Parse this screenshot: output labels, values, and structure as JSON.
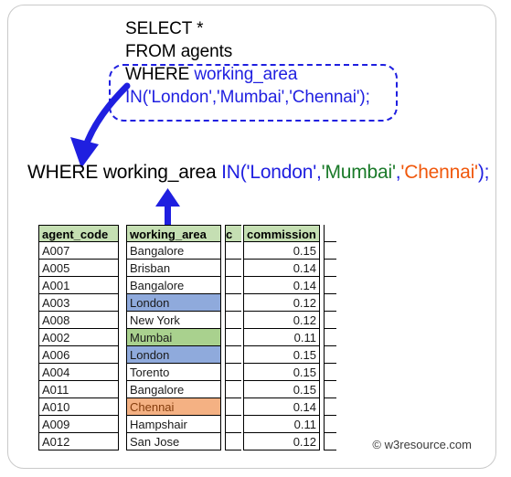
{
  "query": {
    "lines": [
      {
        "id": "l1",
        "segments": [
          {
            "text": "SELECT *",
            "color": "black"
          }
        ]
      },
      {
        "id": "l2",
        "segments": [
          {
            "text": "FROM agents",
            "color": "black"
          }
        ]
      },
      {
        "id": "l3",
        "segments": [
          {
            "text": "WHERE ",
            "color": "black"
          },
          {
            "text": "working_area",
            "color": "blue"
          }
        ]
      },
      {
        "id": "l4",
        "segments": [
          {
            "text": "IN('London','Mumbai','Chennai');",
            "color": "blue"
          }
        ]
      }
    ],
    "line1": "SELECT *",
    "line2": "FROM agents",
    "line3_keyword": "WHERE",
    "line3_column": "working_area",
    "line4": "IN('London','Mumbai','Chennai');"
  },
  "highlight_box": {
    "style": "dashed",
    "color": "#1f1fe0"
  },
  "arrows": {
    "curved": {
      "name": "curved-down-arrow",
      "color": "#1f1fe0"
    },
    "up": {
      "name": "up-arrow",
      "color": "#1f1fe0"
    }
  },
  "where_line": {
    "keyword": "WHERE",
    "column": "working_area",
    "operator_open": "IN(",
    "values": [
      {
        "text": "'London'",
        "color": "#1f1fe0"
      },
      {
        "text": "'Mumbai'",
        "color": "#1a7a29"
      },
      {
        "text": "'Chennai'",
        "color": "#f0580c"
      }
    ],
    "separator": ",",
    "operator_close": ");"
  },
  "table": {
    "headers": [
      "agent_code",
      "working_area",
      "c",
      "commission"
    ],
    "rows": [
      {
        "agent_code": "A007",
        "working_area": "Bangalore",
        "working_area_highlight": "none",
        "commission": "0.15"
      },
      {
        "agent_code": "A005",
        "working_area": "Brisban",
        "working_area_highlight": "none",
        "commission": "0.14"
      },
      {
        "agent_code": "A001",
        "working_area": "Bangalore",
        "working_area_highlight": "none",
        "commission": "0.14"
      },
      {
        "agent_code": "A003",
        "working_area": "London",
        "working_area_highlight": "blue",
        "commission": "0.12"
      },
      {
        "agent_code": "A008",
        "working_area": "New York",
        "working_area_highlight": "none",
        "commission": "0.12"
      },
      {
        "agent_code": "A002",
        "working_area": "Mumbai",
        "working_area_highlight": "green",
        "commission": "0.11"
      },
      {
        "agent_code": "A006",
        "working_area": "London",
        "working_area_highlight": "blue",
        "commission": "0.15"
      },
      {
        "agent_code": "A004",
        "working_area": "Torento",
        "working_area_highlight": "none",
        "commission": "0.15"
      },
      {
        "agent_code": "A011",
        "working_area": "Bangalore",
        "working_area_highlight": "none",
        "commission": "0.15"
      },
      {
        "agent_code": "A010",
        "working_area": "Chennai",
        "working_area_highlight": "orange",
        "commission": "0.14"
      },
      {
        "agent_code": "A009",
        "working_area": "Hampshair",
        "working_area_highlight": "none",
        "commission": "0.11"
      },
      {
        "agent_code": "A012",
        "working_area": "San Jose",
        "working_area_highlight": "none",
        "commission": "0.12"
      }
    ],
    "colors": {
      "header_bg": "#c5dfb3",
      "highlight_blue": "#8faadc",
      "highlight_green": "#a9d18e",
      "highlight_orange": "#f4b183"
    }
  },
  "footer": {
    "copyright_symbol": "©",
    "text": "w3resource.com"
  }
}
